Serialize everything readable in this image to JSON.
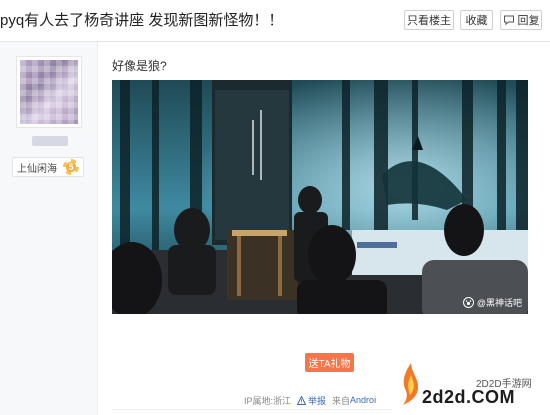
{
  "thread": {
    "title": "pyq有人去了杨奇讲座 发现新图新怪物！！",
    "buttons": {
      "only_author": "只看楼主",
      "favorite": "收藏",
      "reply": "回复"
    }
  },
  "author": {
    "level_name": "上仙闲海",
    "level_number": "5"
  },
  "post": {
    "text": "好像是狼?",
    "image_watermark": "@黑神话吧",
    "gift_button": "送TA礼物",
    "meta": {
      "ip_location": "IP属地:浙江",
      "report": "举报",
      "source_prefix": "来自",
      "source_device": "Androi"
    }
  },
  "site_logo": {
    "subtitle": "2D2D手游网",
    "main": "2d2d.COM"
  },
  "colors": {
    "gift_button": "#f4764a",
    "link": "#3c6ab4",
    "sidebar_bg": "#f7f8fa"
  },
  "icons": [
    "reply-icon",
    "level-badge-icon",
    "report-icon",
    "watermark-paw-icon",
    "flame-logo-icon"
  ]
}
